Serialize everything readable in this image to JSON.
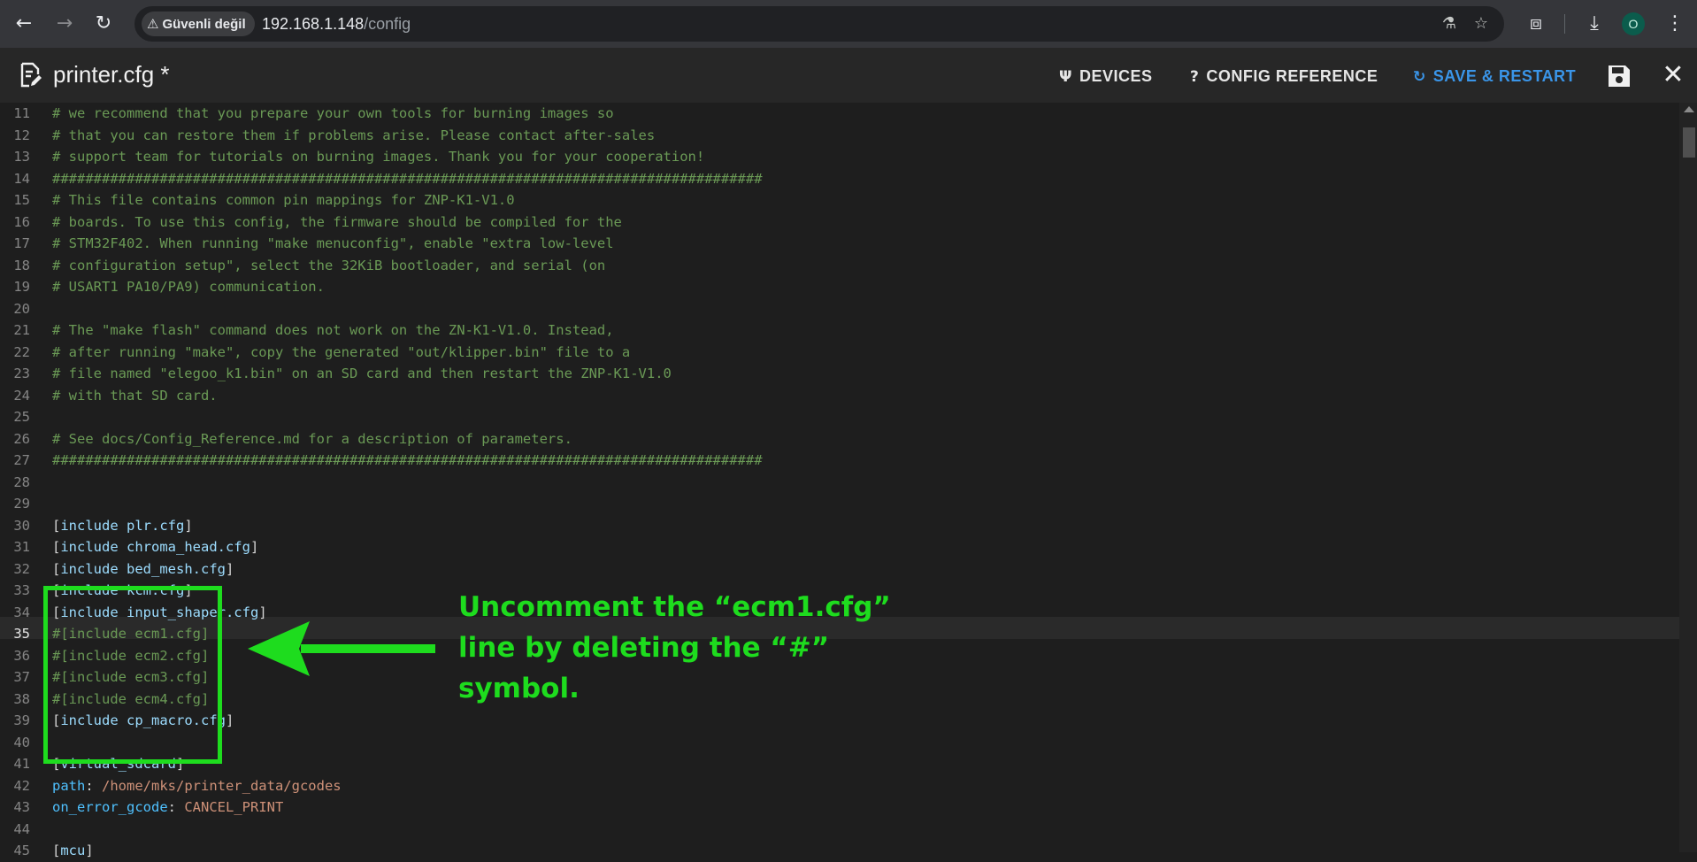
{
  "browser": {
    "security_label": "Güvenli değil",
    "url_host": "192.168.1.148",
    "url_path": "/config",
    "profile_initial": "O"
  },
  "header": {
    "file_title": "printer.cfg *",
    "devices_label": "DEVICES",
    "config_reference_label": "CONFIG REFERENCE",
    "save_restart_label": "SAVE & RESTART"
  },
  "editor": {
    "active_line_number": 35,
    "lines": [
      {
        "n": "11",
        "segs": [
          {
            "t": "# we recommend that you prepare your own tools for burning images so",
            "c": "comment"
          }
        ]
      },
      {
        "n": "12",
        "segs": [
          {
            "t": "# that you can restore them if problems arise. Please contact after-sales",
            "c": "comment"
          }
        ]
      },
      {
        "n": "13",
        "segs": [
          {
            "t": "# support team for tutorials on burning images. Thank you for your cooperation!",
            "c": "comment"
          }
        ]
      },
      {
        "n": "14",
        "segs": [
          {
            "t": "######################################################################################",
            "c": "comment"
          }
        ]
      },
      {
        "n": "15",
        "segs": [
          {
            "t": "# This file contains common pin mappings for ZNP-K1-V1.0",
            "c": "comment"
          }
        ]
      },
      {
        "n": "16",
        "segs": [
          {
            "t": "# boards. To use this config, the firmware should be compiled for the",
            "c": "comment"
          }
        ]
      },
      {
        "n": "17",
        "segs": [
          {
            "t": "# STM32F402. When running \"make menuconfig\", enable \"extra low-level",
            "c": "comment"
          }
        ]
      },
      {
        "n": "18",
        "segs": [
          {
            "t": "# configuration setup\", select the 32KiB bootloader, and serial (on",
            "c": "comment"
          }
        ]
      },
      {
        "n": "19",
        "segs": [
          {
            "t": "# USART1 PA10/PA9) communication.",
            "c": "comment"
          }
        ]
      },
      {
        "n": "20",
        "segs": []
      },
      {
        "n": "21",
        "segs": [
          {
            "t": "# The \"make flash\" command does not work on the ZN-K1-V1.0. Instead,",
            "c": "comment"
          }
        ]
      },
      {
        "n": "22",
        "segs": [
          {
            "t": "# after running \"make\", copy the generated \"out/klipper.bin\" file to a",
            "c": "comment"
          }
        ]
      },
      {
        "n": "23",
        "segs": [
          {
            "t": "# file named \"elegoo_k1.bin\" on an SD card and then restart the ZNP-K1-V1.0",
            "c": "comment"
          }
        ]
      },
      {
        "n": "24",
        "segs": [
          {
            "t": "# with that SD card.",
            "c": "comment"
          }
        ]
      },
      {
        "n": "25",
        "segs": []
      },
      {
        "n": "26",
        "segs": [
          {
            "t": "# See docs/Config_Reference.md for a description of parameters.",
            "c": "comment"
          }
        ]
      },
      {
        "n": "27",
        "segs": [
          {
            "t": "######################################################################################",
            "c": "comment"
          }
        ]
      },
      {
        "n": "28",
        "segs": []
      },
      {
        "n": "29",
        "segs": []
      },
      {
        "n": "30",
        "segs": [
          {
            "t": "[",
            "c": "br"
          },
          {
            "t": "include plr.cfg",
            "c": "section"
          },
          {
            "t": "]",
            "c": "br"
          }
        ]
      },
      {
        "n": "31",
        "segs": [
          {
            "t": "[",
            "c": "br"
          },
          {
            "t": "include chroma_head.cfg",
            "c": "section"
          },
          {
            "t": "]",
            "c": "br"
          }
        ]
      },
      {
        "n": "32",
        "segs": [
          {
            "t": "[",
            "c": "br"
          },
          {
            "t": "include bed_mesh.cfg",
            "c": "section"
          },
          {
            "t": "]",
            "c": "br"
          }
        ]
      },
      {
        "n": "33",
        "segs": [
          {
            "t": "[",
            "c": "br"
          },
          {
            "t": "include kcm.cfg",
            "c": "section"
          },
          {
            "t": "]",
            "c": "br"
          }
        ]
      },
      {
        "n": "34",
        "segs": [
          {
            "t": "[",
            "c": "br"
          },
          {
            "t": "include input_shaper.cfg",
            "c": "section"
          },
          {
            "t": "]",
            "c": "br"
          }
        ]
      },
      {
        "n": "35",
        "segs": [
          {
            "t": "#[include ecm1.cfg]",
            "c": "comment"
          }
        ]
      },
      {
        "n": "36",
        "segs": [
          {
            "t": "#[include ecm2.cfg]",
            "c": "comment"
          }
        ]
      },
      {
        "n": "37",
        "segs": [
          {
            "t": "#[include ecm3.cfg]",
            "c": "comment"
          }
        ]
      },
      {
        "n": "38",
        "segs": [
          {
            "t": "#[include ecm4.cfg]",
            "c": "comment"
          }
        ]
      },
      {
        "n": "39",
        "segs": [
          {
            "t": "[",
            "c": "br"
          },
          {
            "t": "include cp_macro.cfg",
            "c": "section"
          },
          {
            "t": "]",
            "c": "br"
          }
        ]
      },
      {
        "n": "40",
        "segs": []
      },
      {
        "n": "41",
        "segs": [
          {
            "t": "[",
            "c": "br"
          },
          {
            "t": "virtual_sdcard",
            "c": "section"
          },
          {
            "t": "]",
            "c": "br"
          }
        ]
      },
      {
        "n": "42",
        "segs": [
          {
            "t": "path",
            "c": "key"
          },
          {
            "t": ": ",
            "c": "br"
          },
          {
            "t": "/home/mks/printer_data/gcodes",
            "c": "val"
          }
        ]
      },
      {
        "n": "43",
        "segs": [
          {
            "t": "on_error_gcode",
            "c": "key"
          },
          {
            "t": ": ",
            "c": "br"
          },
          {
            "t": "CANCEL_PRINT",
            "c": "val"
          }
        ]
      },
      {
        "n": "44",
        "segs": []
      },
      {
        "n": "45",
        "segs": [
          {
            "t": "[",
            "c": "br"
          },
          {
            "t": "mcu",
            "c": "section"
          },
          {
            "t": "]",
            "c": "br"
          }
        ]
      }
    ]
  },
  "annotation": {
    "lines": [
      "Uncomment the “ecm1.cfg”",
      "line by deleting the “#”",
      "symbol."
    ],
    "color": "#1edc1e"
  },
  "colors": {
    "comment": "#6a9955",
    "section": "#9cdcfe",
    "key": "#4fc1ff",
    "value": "#ce9178",
    "save_restart": "#3a95e8"
  },
  "icons": {
    "back": "arrow-left-icon",
    "forward": "arrow-right-icon",
    "reload": "reload-icon",
    "translate": "translate-icon",
    "bookmark": "star-icon",
    "extensions": "puzzle-icon",
    "download": "download-icon",
    "menu": "kebab-menu-icon",
    "file": "file-edit-icon",
    "devices": "usb-icon",
    "reference": "question-icon",
    "restart": "restart-icon",
    "save": "floppy-disk-icon",
    "close": "close-icon"
  }
}
